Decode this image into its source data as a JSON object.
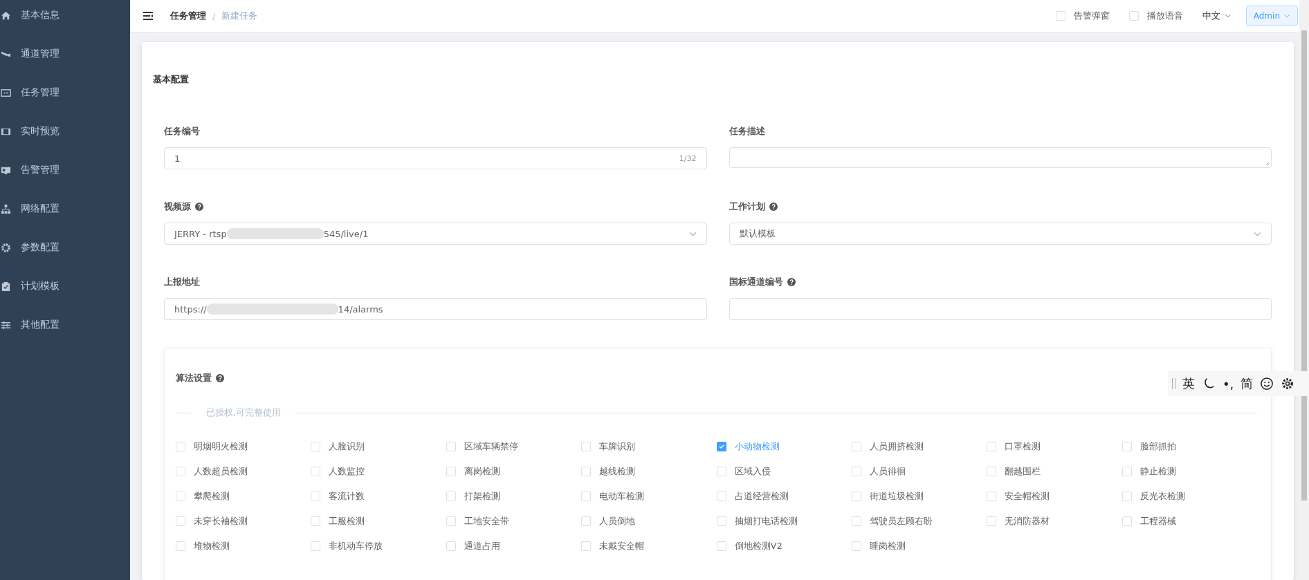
{
  "sidebar": {
    "items": [
      {
        "label": "基本信息",
        "selected": false
      },
      {
        "label": "通道管理",
        "selected": false
      },
      {
        "label": "任务管理",
        "selected": false
      },
      {
        "label": "实时预览",
        "selected": false
      },
      {
        "label": "告警管理",
        "selected": false
      },
      {
        "label": "网络配置",
        "selected": false
      },
      {
        "label": "参数配置",
        "selected": false
      },
      {
        "label": "计划模板",
        "selected": false
      },
      {
        "label": "其他配置",
        "selected": false
      }
    ]
  },
  "breadcrumb": [
    "任务管理",
    "/",
    "新建任务"
  ],
  "header": {
    "options": [
      {
        "label": "告警弹窗",
        "checked": false
      },
      {
        "label": "播放语音",
        "checked": false
      }
    ],
    "language": "中文",
    "user": "Admin"
  },
  "basic": {
    "title": "基本配置",
    "task_no": {
      "label": "任务编号",
      "value": "1",
      "count": "1/32"
    },
    "description": {
      "label": "任务描述"
    },
    "video_source": {
      "label": "视频源",
      "value_start": "JERRY - rtsp",
      "value_end": "545/live/1"
    },
    "schedule": {
      "label": "工作计划",
      "value": "默认模板"
    },
    "report_url": {
      "label": "上报地址",
      "value_start": "https://",
      "value_end": "14/alarms"
    },
    "gb_channel": {
      "label": "国标通道编号"
    }
  },
  "algorithms": {
    "title": "算法设置",
    "divider": "已授权,可完整使用",
    "items": [
      {
        "label": "明烟明火检测",
        "checked": false
      },
      {
        "label": "人脸识别",
        "checked": false
      },
      {
        "label": "区域车辆禁停",
        "checked": false
      },
      {
        "label": "车牌识别",
        "checked": false
      },
      {
        "label": "小动物检测",
        "checked": true
      },
      {
        "label": "人员拥挤检测",
        "checked": false
      },
      {
        "label": "口罩检测",
        "checked": false
      },
      {
        "label": "脸部抓拍",
        "checked": false
      },
      {
        "label": "人数超员检测",
        "checked": false
      },
      {
        "label": "人数监控",
        "checked": false
      },
      {
        "label": "离岗检测",
        "checked": false
      },
      {
        "label": "越线检测",
        "checked": false
      },
      {
        "label": "区域入侵",
        "checked": false
      },
      {
        "label": "人员徘徊",
        "checked": false
      },
      {
        "label": "翻越围栏",
        "checked": false
      },
      {
        "label": "静止检测",
        "checked": false
      },
      {
        "label": "攀爬检测",
        "checked": false
      },
      {
        "label": "客流计数",
        "checked": false
      },
      {
        "label": "打架检测",
        "checked": false
      },
      {
        "label": "电动车检测",
        "checked": false
      },
      {
        "label": "占道经营检测",
        "checked": false
      },
      {
        "label": "街道垃圾检测",
        "checked": false
      },
      {
        "label": "安全帽检测",
        "checked": false
      },
      {
        "label": "反光衣检测",
        "checked": false
      },
      {
        "label": "未穿长袖检测",
        "checked": false
      },
      {
        "label": "工服检测",
        "checked": false
      },
      {
        "label": "工地安全带",
        "checked": false
      },
      {
        "label": "人员倒地",
        "checked": false
      },
      {
        "label": "抽烟打电话检测",
        "checked": false
      },
      {
        "label": "驾驶员左顾右盼",
        "checked": false
      },
      {
        "label": "无消防器材",
        "checked": false
      },
      {
        "label": "工程器械",
        "checked": false
      },
      {
        "label": "堆物检测",
        "checked": false
      },
      {
        "label": "非机动车停放",
        "checked": false
      },
      {
        "label": "通道占用",
        "checked": false
      },
      {
        "label": "未戴安全帽",
        "checked": false
      },
      {
        "label": "倒地检测V2",
        "checked": false
      },
      {
        "label": "睡岗检测",
        "checked": false
      }
    ]
  },
  "ime_toolbar": {
    "mode": "英",
    "punctuation": "•,",
    "script": "简"
  }
}
